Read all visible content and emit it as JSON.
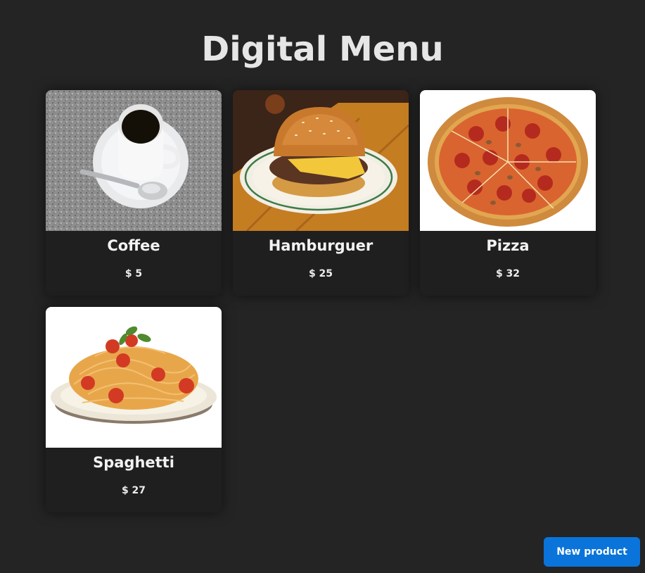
{
  "page": {
    "title": "Digital Menu"
  },
  "products": [
    {
      "name": "Coffee",
      "price": "$ 5",
      "image": "coffee-cup-image"
    },
    {
      "name": "Hamburguer",
      "price": "$ 25",
      "image": "hamburger-image"
    },
    {
      "name": "Pizza",
      "price": "$ 32",
      "image": "pizza-image"
    },
    {
      "name": "Spaghetti",
      "price": "$ 27",
      "image": "spaghetti-image"
    }
  ],
  "actions": {
    "new_product_label": "New product"
  },
  "colors": {
    "background": "#242424",
    "card": "#1f1f1f",
    "accent": "#0a74da"
  }
}
